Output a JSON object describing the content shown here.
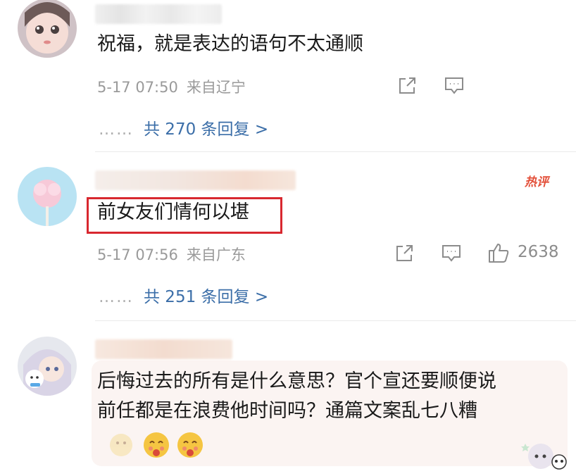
{
  "comments": [
    {
      "text": "祝福，就是表达的语句不太通顺",
      "date": "5-17 07:50",
      "location": "来自辽宁",
      "replies": "共 270 条回复 >"
    },
    {
      "text": "前女友们情何以堪",
      "date": "5-17 07:56",
      "location": "来自广东",
      "likes": "2638",
      "badge": "热评",
      "replies": "共 251 条回复 >"
    },
    {
      "text_line1": "后悔过去的所有是什么意思？官个宣还要顺便说",
      "text_line2": "前任都是在浪费他时间吗？通篇文案乱七八糟"
    }
  ],
  "reply_dots": "……",
  "icons": [
    "share-icon",
    "comment-icon",
    "like-icon",
    "emoji-icon"
  ],
  "colors": {
    "reply_link": "#3b6ea8",
    "meta_gray": "#9a9a9a",
    "highlight": "#d8282f",
    "hot_badge": "#e3503a",
    "bubble_bg": "#fbf4f2"
  }
}
